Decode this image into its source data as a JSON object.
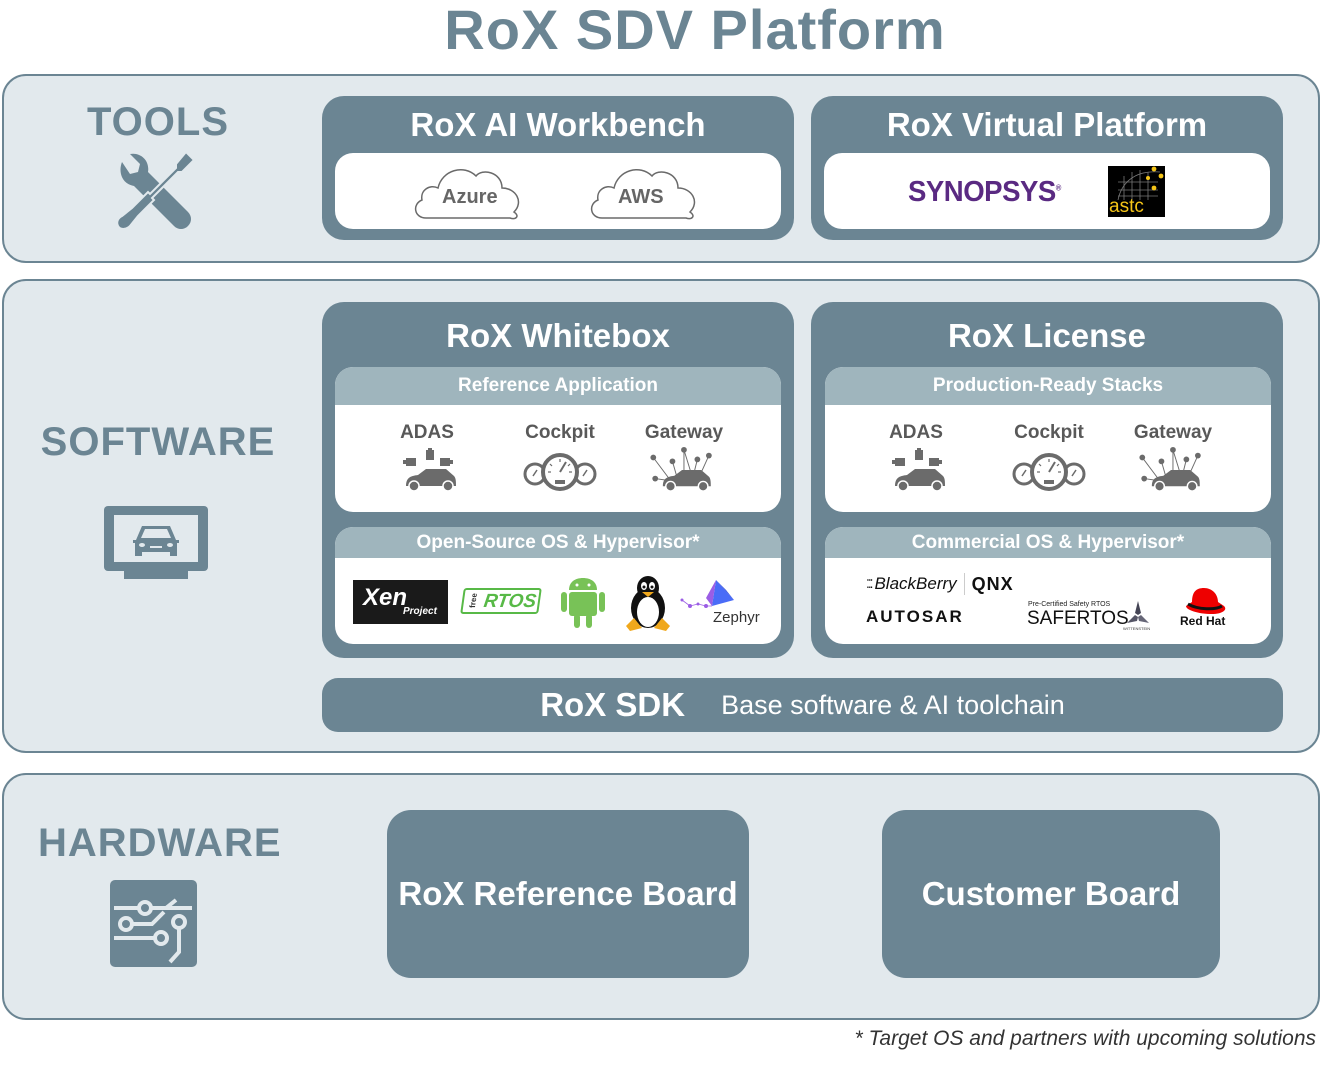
{
  "title": "RoX SDV Platform",
  "colors": {
    "primary": "#6b8593",
    "layer_bg": "#e2e9ed",
    "sub_header": "#9fb5bd",
    "synopsys_purple": "#5a2a82",
    "android_green": "#78c257",
    "redhat_red": "#ee0000"
  },
  "layers": {
    "tools": {
      "label": "TOOLS",
      "icon": "wrench-screwdriver-icon",
      "cards": [
        {
          "title": "RoX AI Workbench",
          "items": [
            "Azure",
            "AWS"
          ]
        },
        {
          "title": "RoX Virtual Platform",
          "logos": [
            "synopsys",
            "astc"
          ]
        }
      ]
    },
    "software": {
      "label": "SOFTWARE",
      "icon": "monitor-car-icon",
      "whitebox": {
        "title": "RoX Whitebox",
        "apps_header": "Reference Application",
        "apps": [
          "ADAS",
          "Cockpit",
          "Gateway"
        ],
        "os_header": "Open-Source OS & Hypervisor*",
        "os_logos": [
          "Xen Project",
          "FreeRTOS",
          "Android",
          "Linux",
          "Zephyr"
        ]
      },
      "license": {
        "title": "RoX License",
        "apps_header": "Production-Ready Stacks",
        "apps": [
          "ADAS",
          "Cockpit",
          "Gateway"
        ],
        "os_header": "Commercial OS & Hypervisor*",
        "os_logos": [
          "BlackBerry QNX",
          "AUTOSAR",
          "SAFERTOS",
          "Red Hat"
        ]
      },
      "sdk": {
        "title": "RoX SDK",
        "subtitle": "Base software & AI toolchain"
      }
    },
    "hardware": {
      "label": "HARDWARE",
      "icon": "circuit-board-icon",
      "boards": [
        "RoX Reference Board",
        "Customer Board"
      ]
    }
  },
  "logo_text": {
    "synopsys": "SYNOPSYS",
    "astc": "astc",
    "xen": "Xen",
    "xen_sub": "Project",
    "freertos_free": "free",
    "freertos_rtos": "RTOS",
    "zephyr": "Zephyr",
    "blackberry": "BlackBerry",
    "qnx": "QNX",
    "autosar": "AUTOSAR",
    "safertos_pre": "Pre-Certified Safety RTOS",
    "safertos": "SAFERTOS",
    "wittenstein": "WITTENSTEIN",
    "redhat": "Red Hat"
  },
  "footnote": "* Target OS and partners with upcoming solutions"
}
